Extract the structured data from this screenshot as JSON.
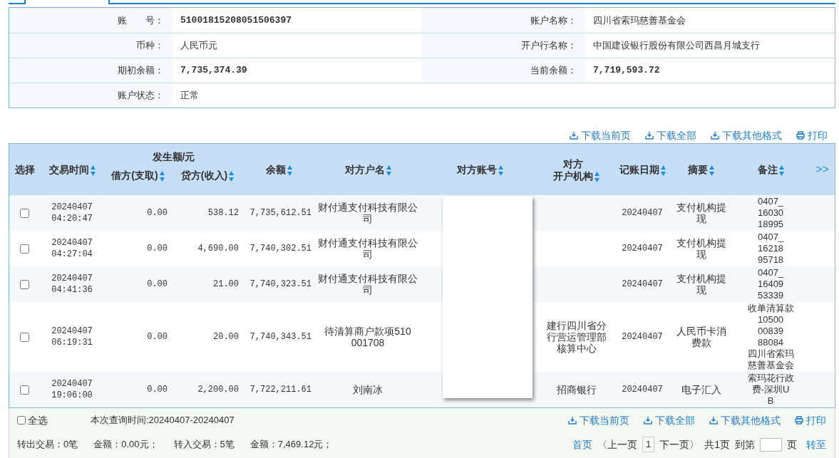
{
  "account_info": [
    {
      "label": "账　　号：",
      "value": "51001815208051506397",
      "mono": true
    },
    {
      "label": "账户名称：",
      "value": "四川省索玛慈善基金会",
      "mono": false
    },
    {
      "label": "币种：",
      "value": "人民币元",
      "mono": false
    },
    {
      "label": "开户行名称：",
      "value": "中国建设银行股份有限公司西昌月城支行",
      "mono": false
    },
    {
      "label": "期初余额：",
      "value": "7,735,374.39",
      "mono": true
    },
    {
      "label": "当前余额：",
      "value": "7,719,593.72",
      "mono": true
    },
    {
      "label": "账户状态：",
      "value": "正常",
      "mono": false
    }
  ],
  "actions": [
    {
      "label": "下载当前页",
      "kind": "download"
    },
    {
      "label": "下载全部",
      "kind": "download"
    },
    {
      "label": "下载其他格式",
      "kind": "download"
    },
    {
      "label": "打印",
      "kind": "print"
    }
  ],
  "table": {
    "group_header": "发生额/元",
    "more": ">>",
    "columns": [
      {
        "label": "选择",
        "sortable": false
      },
      {
        "label": "交易时间",
        "sortable": true
      },
      {
        "label": "借方(支取)",
        "sortable": true
      },
      {
        "label": "贷方(收入)",
        "sortable": true
      },
      {
        "label": "余额",
        "sortable": true
      },
      {
        "label": "对方户名",
        "sortable": true
      },
      {
        "label": "对方账号",
        "sortable": true
      },
      {
        "lines": [
          "对方",
          "开户机构"
        ],
        "sortable": true
      },
      {
        "label": "记账日期",
        "sortable": true
      },
      {
        "label": "摘要",
        "sortable": true
      },
      {
        "label": "备注",
        "sortable": true
      }
    ],
    "rows": [
      {
        "checked": false,
        "time": "20240407\n04:20:47",
        "debit": "0.00",
        "credit": "538.12",
        "balance": "7,735,612.51",
        "name": "财付通支付科技有限公司",
        "bank": "",
        "date": "20240407",
        "summary": "支付机构提现",
        "note": "0407_\n16030\n18995"
      },
      {
        "checked": false,
        "time": "20240407\n04:27:04",
        "debit": "0.00",
        "credit": "4,690.00",
        "balance": "7,740,302.51",
        "name": "财付通支付科技有限公司",
        "bank": "",
        "date": "20240407",
        "summary": "支付机构提现",
        "note": "0407_\n16218\n95718"
      },
      {
        "checked": false,
        "time": "20240407\n04:41:36",
        "debit": "0.00",
        "credit": "21.00",
        "balance": "7,740,323.51",
        "name": "财付通支付科技有限公司",
        "bank": "",
        "date": "20240407",
        "summary": "支付机构提现",
        "note": "0407_\n16409\n53339"
      },
      {
        "checked": false,
        "time": "20240407\n06:19:31",
        "debit": "0.00",
        "credit": "20.00",
        "balance": "7,740,343.51",
        "name": "待清算商户款项510\n001708",
        "bank": "建行四川省分行营运管理部核算中心",
        "date": "20240407",
        "summary": "人民币卡消费款",
        "note": "收单清算款\n10500\n00839\n88084\n四川省索玛慈善基金会"
      },
      {
        "checked": false,
        "time": "20240407\n19:06:00",
        "debit": "0.00",
        "credit": "2,200.00",
        "balance": "7,722,211.61",
        "name": "刘南冰",
        "bank": "招商银行",
        "date": "20240407",
        "summary": "电子汇入",
        "note": "索玛花行政费-深圳U\nB"
      }
    ]
  },
  "footer": {
    "select_all": {
      "label": "全选",
      "checked": false
    },
    "query_time": "本次查询时间:20240407-20240407",
    "actions": [
      {
        "label": "下载当前页",
        "kind": "download"
      },
      {
        "label": "下载全部",
        "kind": "download"
      },
      {
        "label": "下载其他格式",
        "kind": "download"
      },
      {
        "label": "打印",
        "kind": "print"
      }
    ],
    "stats": [
      "转出交易：0笔",
      "金额：0.00元；",
      "转入交易：5笔",
      "金额：7,469.12元；"
    ],
    "pager": {
      "first": "首页",
      "prev": "〈上一页",
      "page": "1",
      "next": "下一页〉",
      "total": "共1页",
      "goto_label": "到第",
      "page_unit": "页",
      "go": "转至"
    }
  }
}
